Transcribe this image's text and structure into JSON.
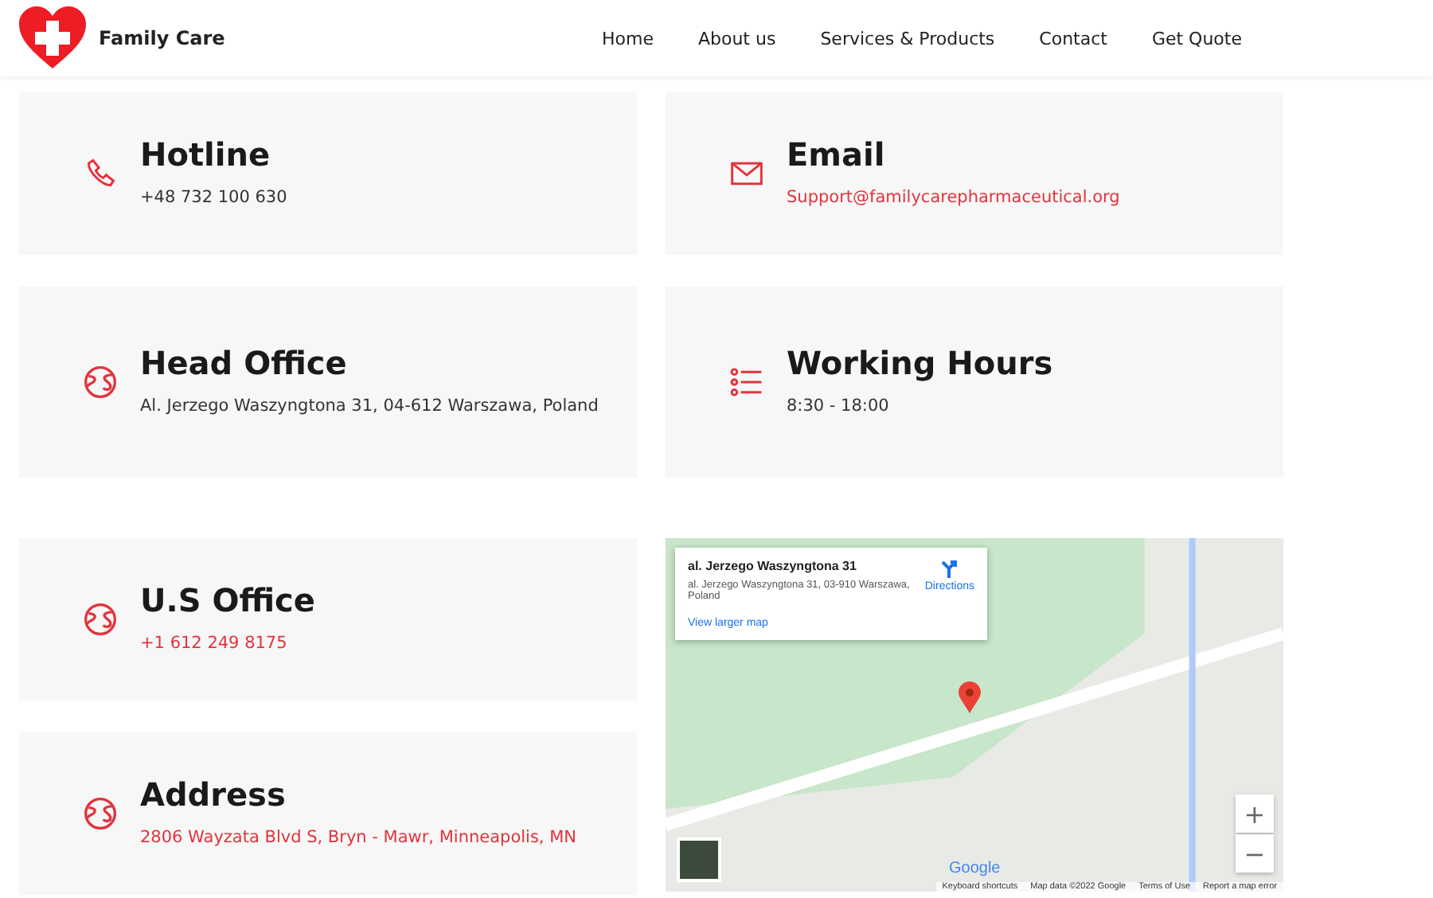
{
  "header": {
    "brand": "Family Care",
    "nav": [
      {
        "label": "Home"
      },
      {
        "label": "About us"
      },
      {
        "label": "Services & Products"
      },
      {
        "label": "Contact"
      },
      {
        "label": "Get Quote"
      }
    ]
  },
  "info_cards": [
    {
      "kind": "phone",
      "title": "Hotline",
      "value": "+48 732 100 630",
      "link": false
    },
    {
      "kind": "mail",
      "title": "Email",
      "value": "Support@familycarepharmaceutical.org",
      "link": true
    },
    {
      "kind": "globe",
      "title": "Head Office",
      "value": "Al. Jerzego Waszyngtona 31, 04-612 Warszawa, Poland",
      "link": false
    },
    {
      "kind": "list",
      "title": "Working Hours",
      "value": "8:30 - 18:00",
      "link": false
    }
  ],
  "lower_cards": [
    {
      "kind": "globe",
      "title": "U.S Office",
      "value": "+1 612 249 8175",
      "link": true
    },
    {
      "kind": "globe",
      "title": "Address",
      "value": "2806 Wayzata Blvd S, Bryn - Mawr, Minneapolis, MN",
      "link": true
    }
  ],
  "map": {
    "place_title": "al. Jerzego Waszyngtona 31",
    "place_address": "al. Jerzego Waszyngtona 31, 03-910 Warszawa, Poland",
    "directions": "Directions",
    "larger_map": "View larger map",
    "zoom_in": "+",
    "zoom_out": "−",
    "logo": "Google",
    "footer": [
      "Keyboard shortcuts",
      "Map data ©2022 Google",
      "Terms of Use",
      "Report a map error"
    ]
  }
}
